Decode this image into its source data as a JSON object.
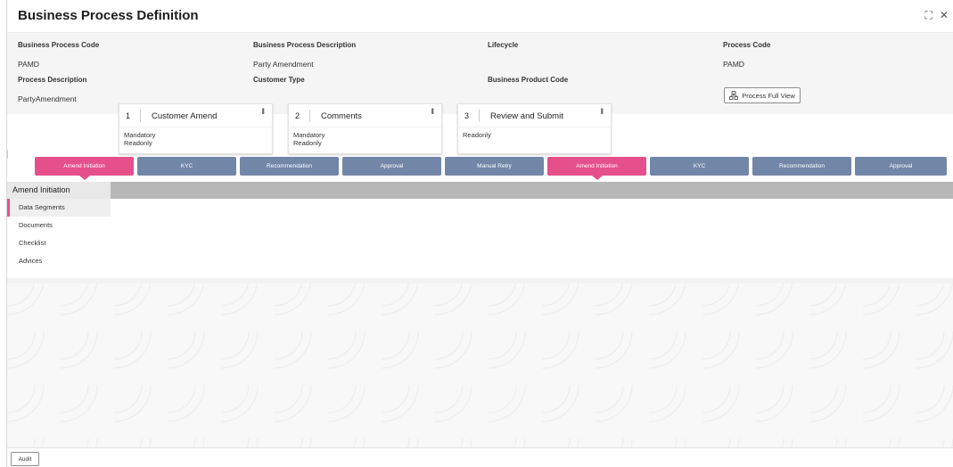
{
  "window": {
    "title": "Business Process Definition",
    "expand_glyph": "⛶",
    "close_glyph": "✕"
  },
  "header": {
    "fields": [
      {
        "label": "Business Process Code",
        "value": "PAMD"
      },
      {
        "label": "Business Process Description",
        "value": "Party Amendment"
      },
      {
        "label": "Lifecycle",
        "value": ""
      },
      {
        "label": "Process Code",
        "value": "PAMD"
      },
      {
        "label": "Process Description",
        "value": "PartyAmendment"
      },
      {
        "label": "Customer Type",
        "value": ""
      },
      {
        "label": "Business Product Code",
        "value": ""
      }
    ],
    "process_full_view_label": "Process Full View",
    "process_full_view_icon": "hierarchy-icon"
  },
  "stages": [
    {
      "label": "Amend Initiation",
      "active": true
    },
    {
      "label": "KYC",
      "active": false
    },
    {
      "label": "Recommendation",
      "active": false
    },
    {
      "label": "Approval",
      "active": false
    },
    {
      "label": "Manual Retry",
      "active": false
    },
    {
      "label": "Amend Initiation",
      "active": true
    },
    {
      "label": "KYC",
      "active": false
    },
    {
      "label": "Recommendation",
      "active": false
    },
    {
      "label": "Approval",
      "active": false
    }
  ],
  "stage_detail": {
    "title": "Amend Initiation",
    "nav": [
      {
        "label": "Data Segments",
        "selected": true
      },
      {
        "label": "Documents",
        "selected": false
      },
      {
        "label": "Checklist",
        "selected": false
      },
      {
        "label": "Advices",
        "selected": false
      }
    ],
    "cards": [
      {
        "num": "1",
        "name": "Customer Amend",
        "tags": [
          "Mandatory",
          "Readonly"
        ]
      },
      {
        "num": "2",
        "name": "Comments",
        "tags": [
          "Mandatory",
          "Readonly"
        ]
      },
      {
        "num": "3",
        "name": "Review and Submit",
        "tags": [
          "Readonly"
        ]
      }
    ]
  },
  "footer": {
    "audit_label": "Audit"
  },
  "colors": {
    "stage_active": "#e6508a",
    "stage_inactive": "#7287a8"
  }
}
